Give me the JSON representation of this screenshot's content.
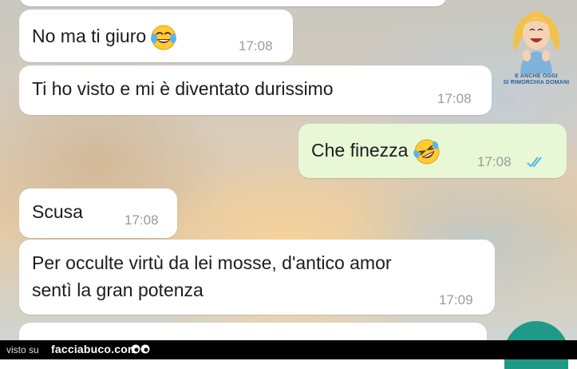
{
  "messages": [
    {
      "direction": "incoming",
      "text": "No ma ti giuro",
      "emoji": "face-with-tears-of-joy",
      "time": "17:08"
    },
    {
      "direction": "incoming",
      "text": "Ti ho visto e mi è diventato durissimo",
      "time": "17:08"
    },
    {
      "direction": "outgoing",
      "text": "Che finezza",
      "emoji": "rolling-on-the-floor-laughing",
      "time": "17:08",
      "status": "read"
    },
    {
      "direction": "incoming",
      "text": "Scusa",
      "time": "17:08"
    },
    {
      "direction": "incoming",
      "lines": [
        "Per occulte virtù da lei mosse, d'antico amor",
        "sentì la gran potenza"
      ],
      "time": "17:09"
    }
  ],
  "sticker": {
    "lines": [
      "E ANCHE OGGI",
      "SI RIMORCHIA DOMANI"
    ]
  },
  "footer": {
    "prefix": "visto su",
    "brand": "facciabuco.com"
  },
  "colors": {
    "incoming_bubble": "#ffffff",
    "outgoing_bubble": "#e8f8d6",
    "read_ticks": "#4fb6ec",
    "fab": "#1f9a86",
    "footer": "#000000"
  }
}
